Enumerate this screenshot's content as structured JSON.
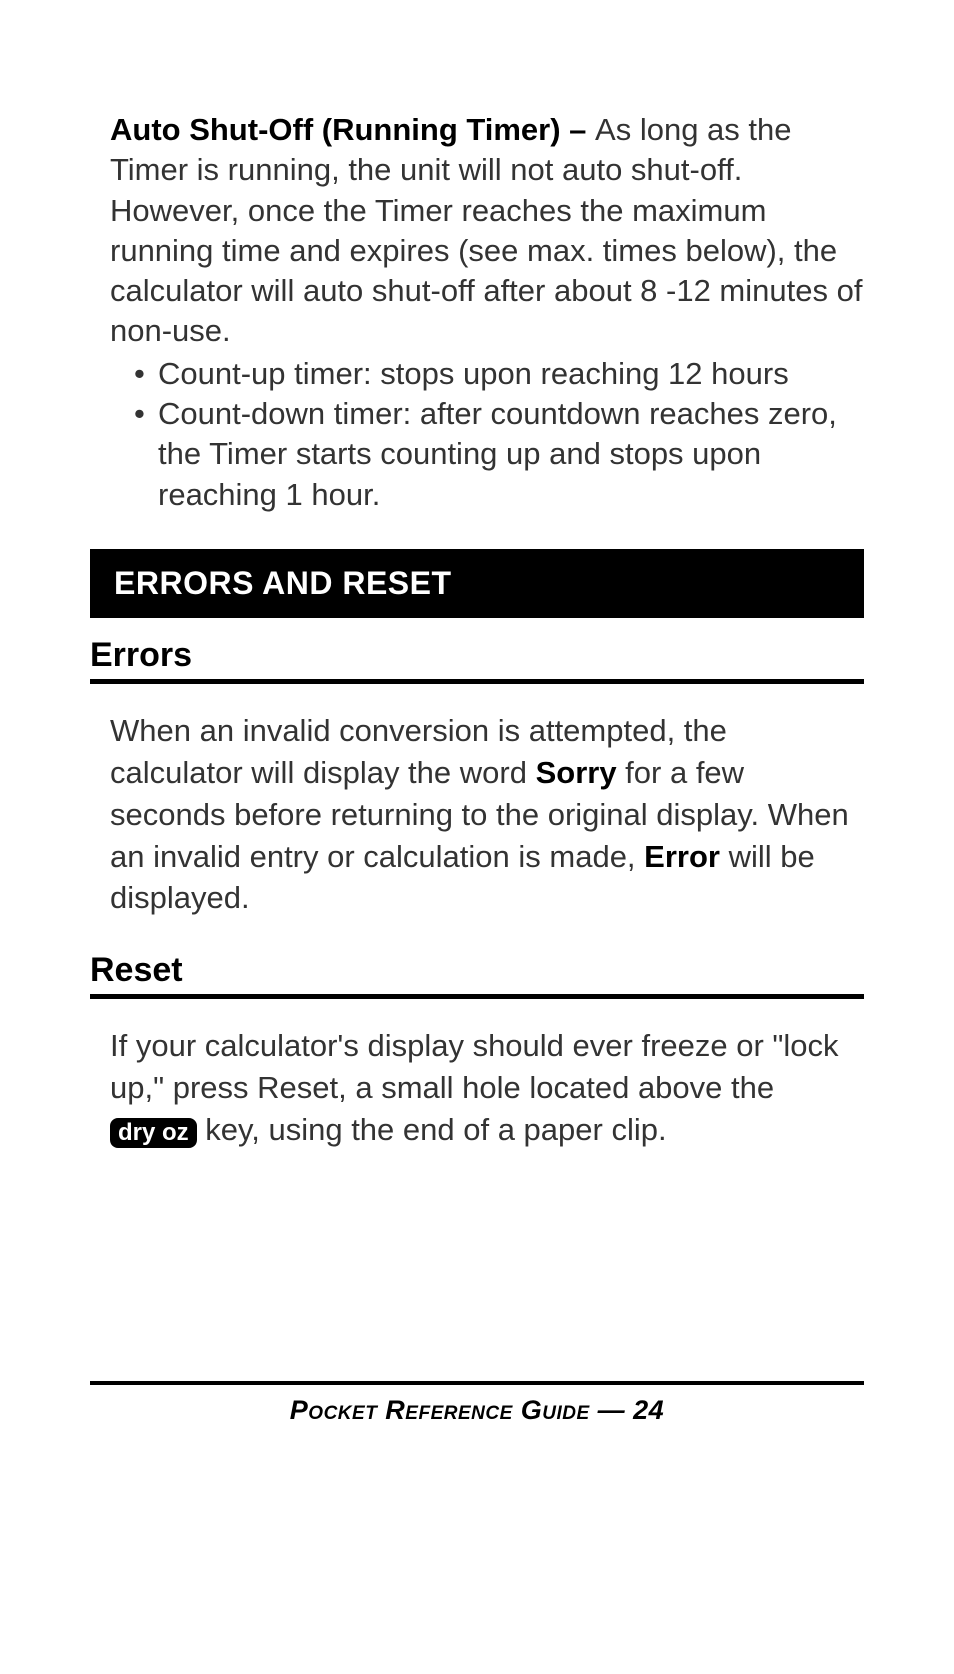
{
  "section1": {
    "title": "Auto Shut-Off (Running Timer) – ",
    "body": "As long as the Timer is running, the unit will not auto shut-off. However, once the Timer reaches the maximum running time and expires (see max. times below), the calculator will auto shut-off after about 8 -12 minutes of non-use.",
    "bullets": [
      "Count-up timer:  stops upon reaching 12 hours",
      "Count-down timer: after countdown reaches zero, the Timer starts counting up and stops upon reaching 1 hour."
    ]
  },
  "bar": "ERRORS AND RESET",
  "errors": {
    "heading": "Errors",
    "text_pre": "When an invalid conversion is attempted, the calculator will display the word ",
    "sorry": "Sorry",
    "text_mid": " for a few seconds before returning to the original display. When an invalid entry or calculation is made, ",
    "error_word": "Error",
    "text_post": " will be displayed."
  },
  "reset": {
    "heading": "Reset",
    "text_pre": "If your calculator's display should ever freeze or \"lock up,\" press Reset, a small hole located above the ",
    "key": "dry oz",
    "text_post": " key, using the end of a paper clip."
  },
  "footer": "Pocket Reference Guide — 24"
}
